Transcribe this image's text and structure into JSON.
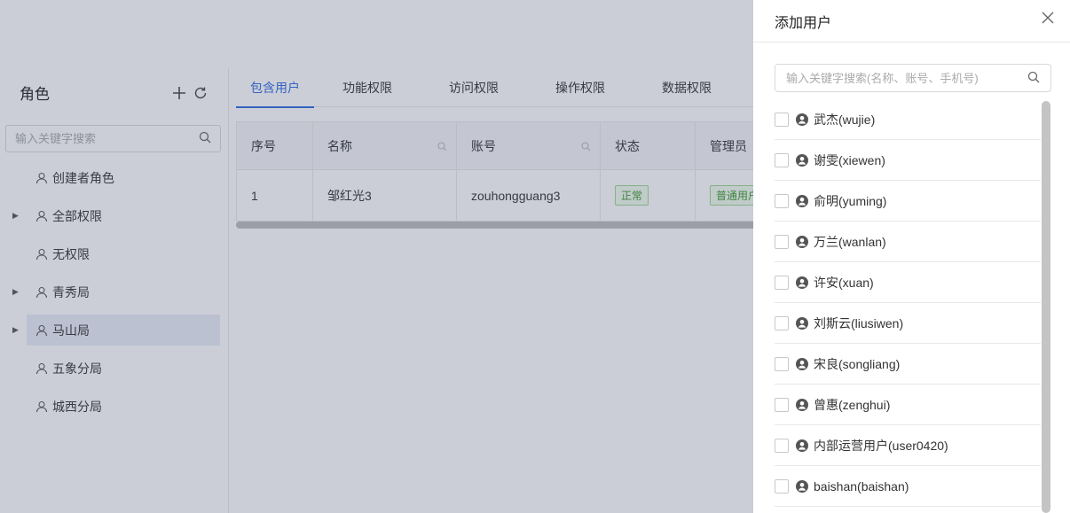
{
  "sidebar": {
    "title": "角色",
    "search_placeholder": "输入关键字搜索",
    "items": [
      {
        "label": "创建者角色",
        "expandable": false,
        "selected": false
      },
      {
        "label": "全部权限",
        "expandable": true,
        "selected": false
      },
      {
        "label": "无权限",
        "expandable": false,
        "selected": false
      },
      {
        "label": "青秀局",
        "expandable": true,
        "selected": false
      },
      {
        "label": "马山局",
        "expandable": true,
        "selected": true
      },
      {
        "label": "五象分局",
        "expandable": false,
        "selected": false
      },
      {
        "label": "城西分局",
        "expandable": false,
        "selected": false
      }
    ]
  },
  "tabs": [
    {
      "label": "包含用户",
      "active": true
    },
    {
      "label": "功能权限",
      "active": false
    },
    {
      "label": "访问权限",
      "active": false
    },
    {
      "label": "操作权限",
      "active": false
    },
    {
      "label": "数据权限",
      "active": false
    }
  ],
  "table": {
    "columns": [
      "序号",
      "名称",
      "账号",
      "状态",
      "管理员"
    ],
    "rows": [
      {
        "index": "1",
        "name": "邹红光3",
        "account": "zouhongguang3",
        "status": "正常",
        "admin": "普通用户"
      }
    ]
  },
  "drawer": {
    "title": "添加用户",
    "search_placeholder": "输入关键字搜索(名称、账号、手机号)",
    "users": [
      "武杰(wujie)",
      "谢雯(xiewen)",
      "俞明(yuming)",
      "万兰(wanlan)",
      "许安(xuan)",
      "刘斯云(liusiwen)",
      "宋良(songliang)",
      "曾惠(zenghui)",
      "内部运营用户(user0420)",
      "baishan(baishan)"
    ]
  },
  "colors": {
    "accent": "#2f6be0",
    "status_green": "#3e9a2c",
    "mask": "rgba(70,80,110,0.28)"
  }
}
